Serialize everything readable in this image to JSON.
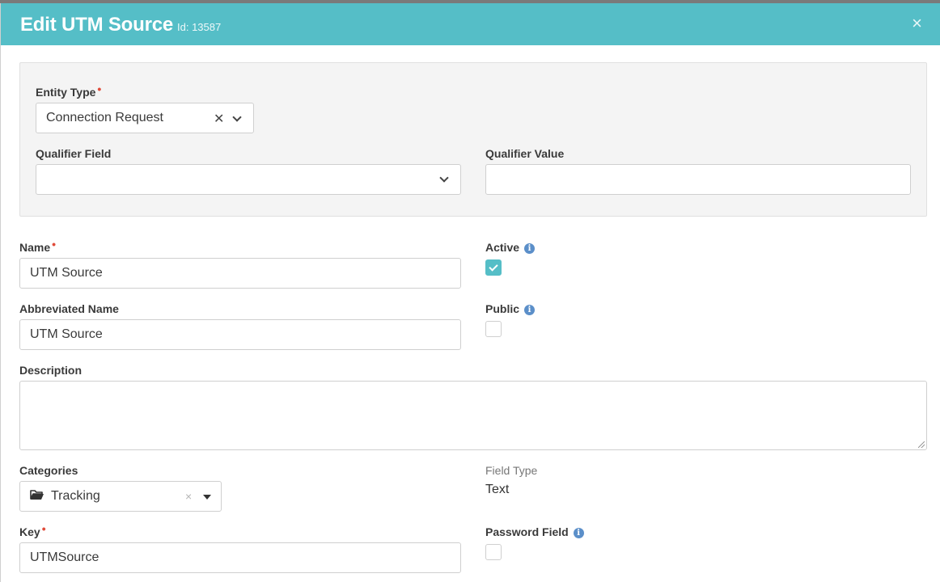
{
  "modal": {
    "title": "Edit UTM Source",
    "id_text": "Id: 13587",
    "close_symbol": "×"
  },
  "filter_panel": {
    "entity_type": {
      "label": "Entity Type",
      "value": "Connection Request",
      "clear_symbol": "✕"
    },
    "qualifier_field": {
      "label": "Qualifier Field",
      "value": ""
    },
    "qualifier_value": {
      "label": "Qualifier Value",
      "value": ""
    }
  },
  "form": {
    "name": {
      "label": "Name",
      "value": "UTM Source"
    },
    "active": {
      "label": "Active",
      "checked": true
    },
    "abbreviated_name": {
      "label": "Abbreviated Name",
      "value": "UTM Source"
    },
    "public": {
      "label": "Public",
      "checked": false
    },
    "description": {
      "label": "Description",
      "value": ""
    },
    "categories": {
      "label": "Categories",
      "value": "Tracking",
      "clear_symbol": "×"
    },
    "field_type": {
      "label": "Field Type",
      "value": "Text"
    },
    "key": {
      "label": "Key",
      "value": "UTMSource"
    },
    "password_field": {
      "label": "Password Field",
      "checked": false
    }
  },
  "required_marker": "•",
  "info_glyph": "i",
  "colors": {
    "header": "#55bec7",
    "accent": "#55bec7",
    "required": "#e04b3a",
    "info": "#5b8fc9"
  },
  "icons": {
    "close": "close-icon",
    "chevron": "chevron-down-icon",
    "caret": "caret-down-icon",
    "folder": "folder-open-icon",
    "info": "info-icon",
    "check": "check-icon"
  }
}
